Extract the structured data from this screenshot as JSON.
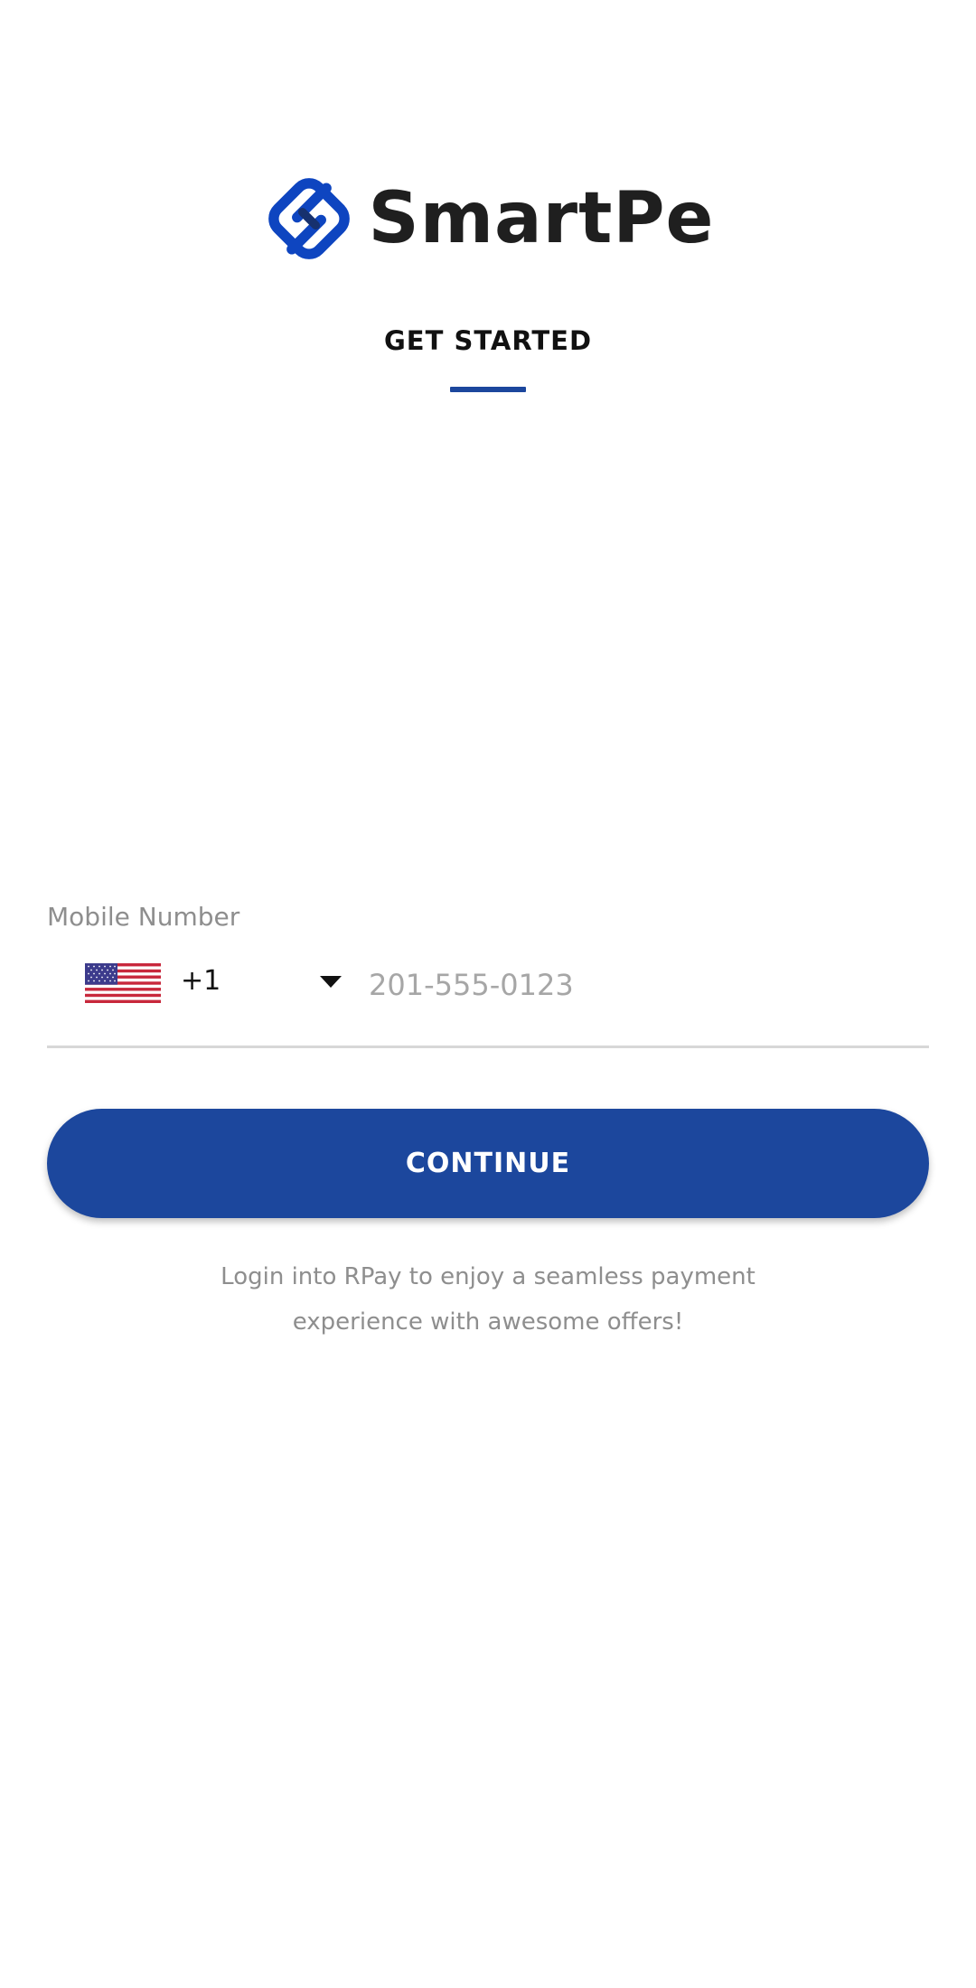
{
  "brand": {
    "name": "SmartPe",
    "logo_icon": "smartpe-s-logo-icon",
    "colors": {
      "primary": "#1c479d",
      "logo_blue": "#0e45c0",
      "text_dark": "#1f1f1f",
      "muted": "#8e8e8e"
    }
  },
  "page": {
    "heading": "GET STARTED"
  },
  "form": {
    "mobile_label": "Mobile Number",
    "country": {
      "flag_icon": "us-flag-icon",
      "dial_code": "+1",
      "dropdown_icon": "caret-down-icon"
    },
    "phone": {
      "value": "",
      "placeholder": "201-555-0123"
    },
    "continue_label": "CONTINUE"
  },
  "helper": {
    "line1": "Login into RPay to enjoy a seamless payment",
    "line2": "experience with awesome offers!"
  }
}
